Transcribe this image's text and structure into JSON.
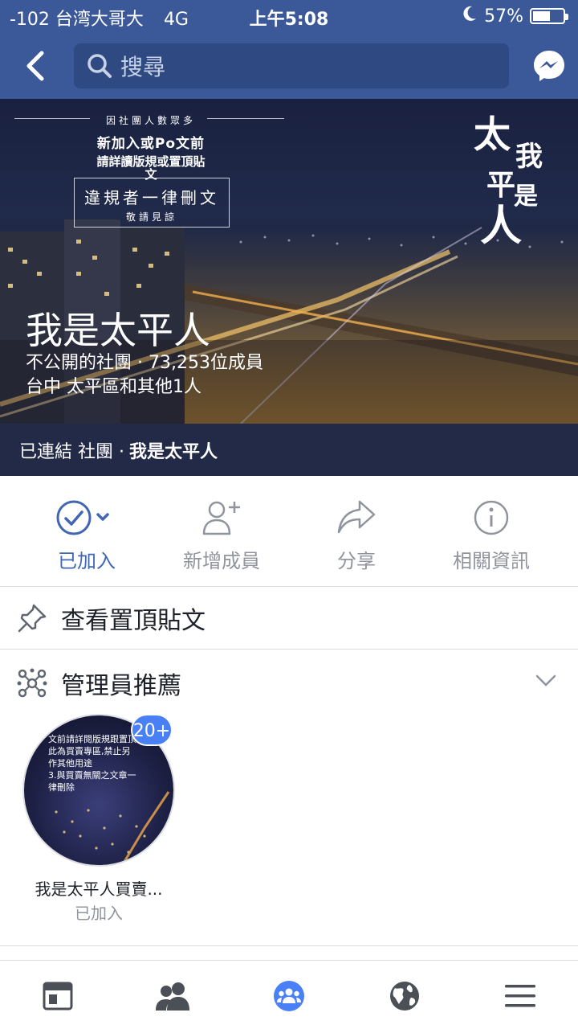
{
  "status_bar": {
    "carrier": "-102 台湾大哥大",
    "network": "4G",
    "time": "上午5:08",
    "battery_text": "57%",
    "battery_level": 0.57
  },
  "search": {
    "placeholder": "搜尋"
  },
  "cover": {
    "notice_small": "因社團人數眾多",
    "notice_line1": "新加入或Po文前",
    "notice_line2": "請詳讀版規或置頂貼文",
    "rule_big": "違規者一律刪文",
    "rule_small": "敬請見諒",
    "calligraphy": [
      "太",
      "我",
      "平",
      "是",
      "人"
    ],
    "group_name": "我是太平人",
    "group_privacy_members": "不公開的社團 · 73,253位成員",
    "group_location": "台中 太平區和其他1人"
  },
  "linked": {
    "prefix": "已連結 社團 ·",
    "name": "我是太平人"
  },
  "actions": [
    {
      "label": "已加入",
      "icon": "check-circle-icon"
    },
    {
      "label": "新增成員",
      "icon": "add-person-icon"
    },
    {
      "label": "分享",
      "icon": "share-arrow-icon"
    },
    {
      "label": "相關資訊",
      "icon": "info-icon"
    }
  ],
  "pinned": {
    "label": "查看置頂貼文"
  },
  "admin": {
    "label": "管理員推薦"
  },
  "recommendation": {
    "badge": "20+",
    "name": "我是太平人買賣...",
    "status": "已加入",
    "image_text": [
      "文前請詳閱版規跟置頂",
      "此為買賣專區,禁止另",
      "作其他用途",
      "3.與買賣無關之文章一",
      "律刪除"
    ]
  },
  "tabs": [
    "news-feed-icon",
    "friends-icon",
    "groups-icon",
    "globe-icon",
    "menu-icon"
  ],
  "colors": {
    "brand": "#3b5998",
    "accent": "#4267b2",
    "badge": "#4a80f5"
  }
}
